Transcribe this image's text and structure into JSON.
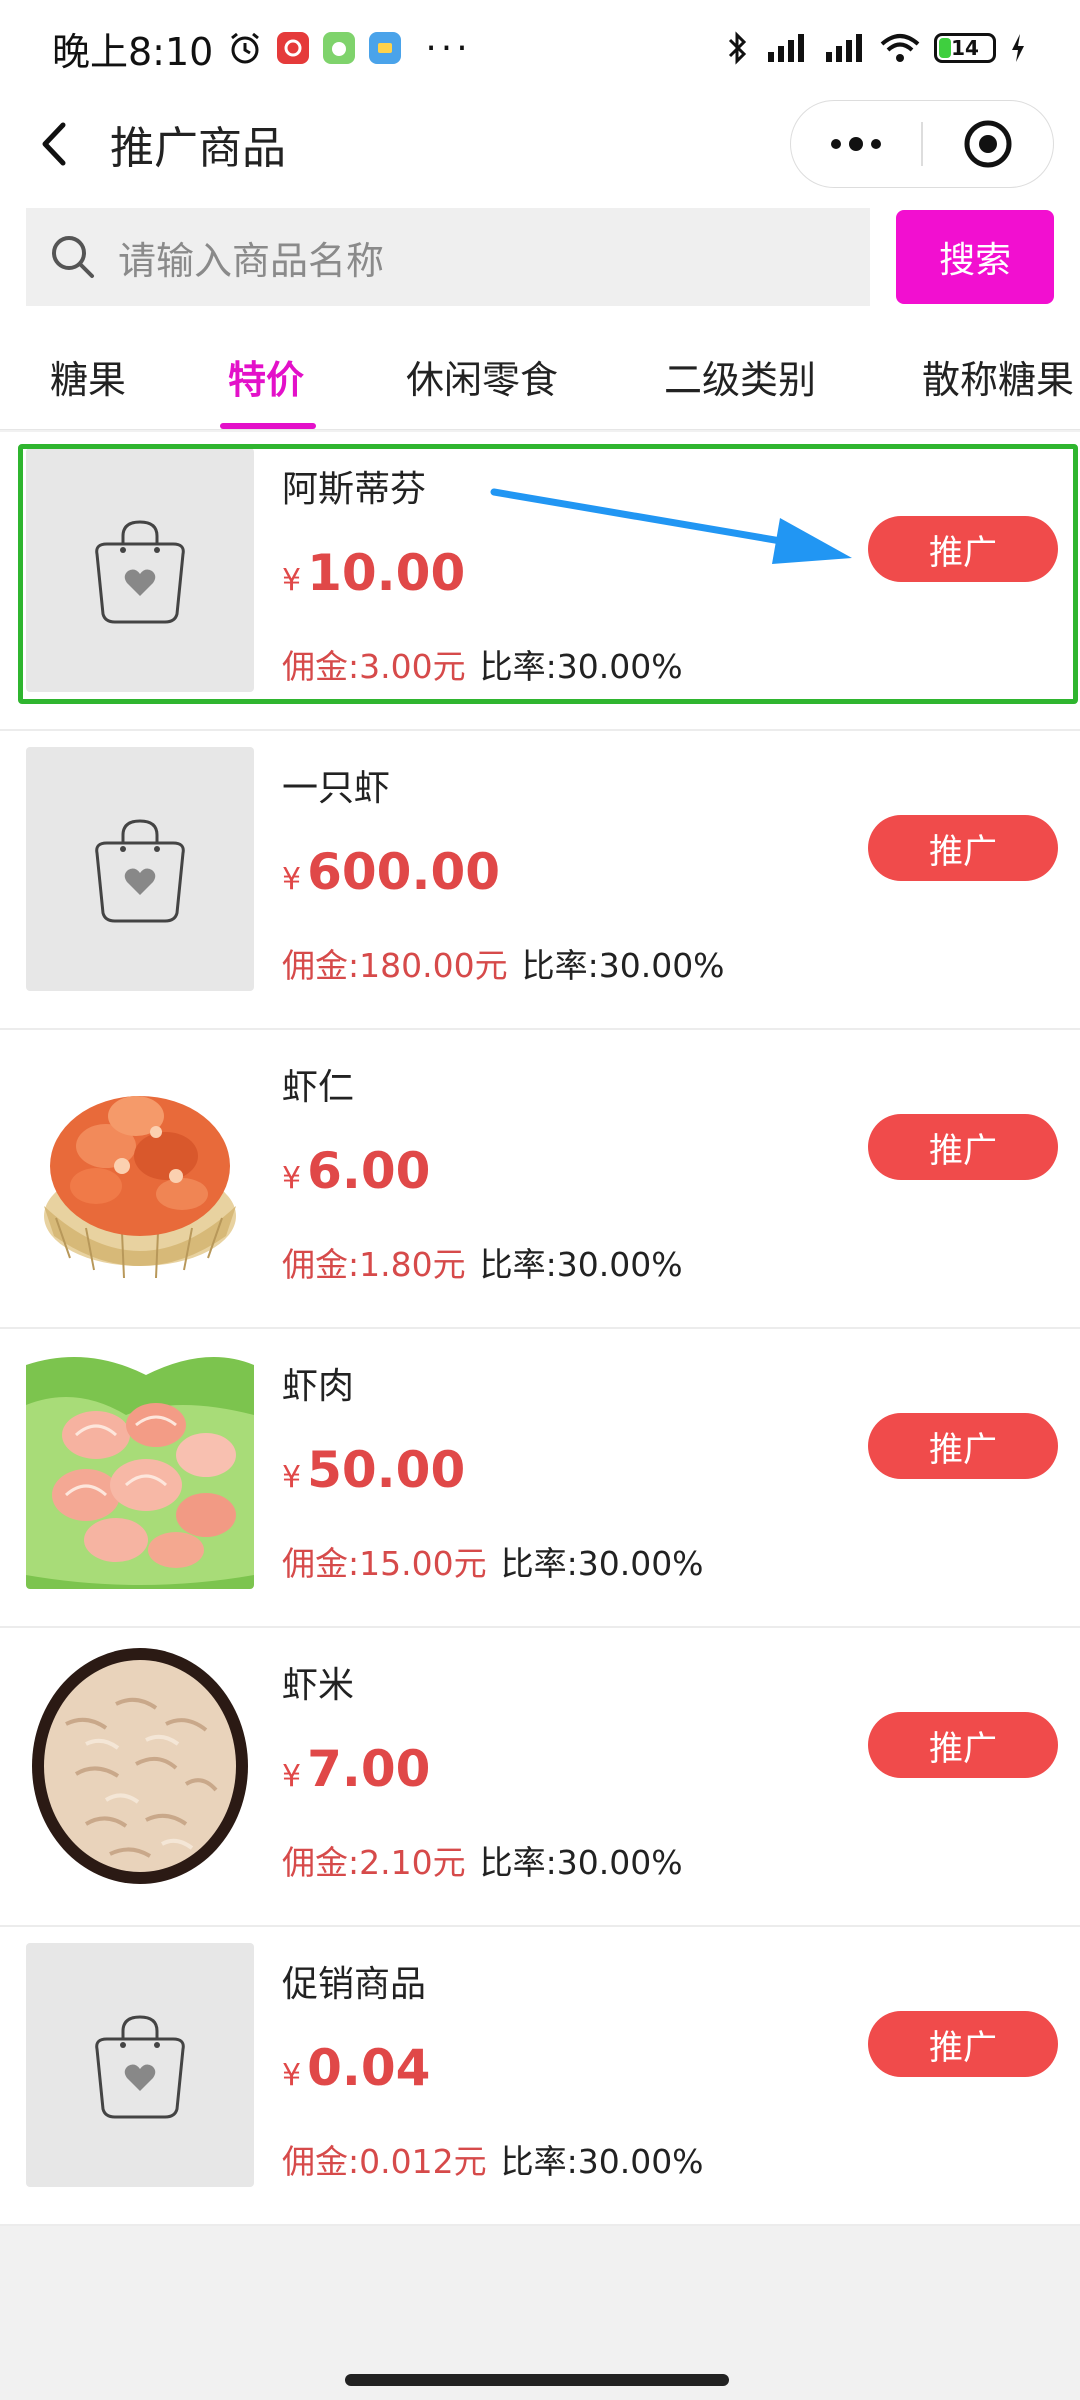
{
  "status_bar": {
    "time": "晚上8:10",
    "dots": "···",
    "battery": "14",
    "icons": [
      "alarm-icon",
      "app-icon-red",
      "app-icon-green",
      "app-icon-blue",
      "bluetooth-icon",
      "signal-hd-icon",
      "signal-hd-icon",
      "wifi-icon",
      "battery-icon",
      "charging-icon"
    ]
  },
  "nav": {
    "title": "推广商品"
  },
  "search": {
    "placeholder": "请输入商品名称",
    "button_label": "搜索"
  },
  "tabs": [
    {
      "label": "糖果",
      "active": false
    },
    {
      "label": "特价",
      "active": true
    },
    {
      "label": "休闲零食",
      "active": false
    },
    {
      "label": "二级类别",
      "active": false
    },
    {
      "label": "散称糖果",
      "active": false
    }
  ],
  "items": [
    {
      "name": "阿斯蒂芬",
      "yen": "¥",
      "price": "10.00",
      "commission": "佣金:3.00元",
      "rate": "比率:30.00%",
      "button": "推广",
      "image": "placeholder-bag"
    },
    {
      "name": "一只虾",
      "yen": "¥",
      "price": "600.00",
      "commission": "佣金:180.00元",
      "rate": "比率:30.00%",
      "button": "推广",
      "image": "placeholder-bag"
    },
    {
      "name": "虾仁",
      "yen": "¥",
      "price": "6.00",
      "commission": "佣金:1.80元",
      "rate": "比率:30.00%",
      "button": "推广",
      "image": "dried-shrimp-basket"
    },
    {
      "name": "虾肉",
      "yen": "¥",
      "price": "50.00",
      "commission": "佣金:15.00元",
      "rate": "比率:30.00%",
      "button": "推广",
      "image": "shrimp-meat-lettuce"
    },
    {
      "name": "虾米",
      "yen": "¥",
      "price": "7.00",
      "commission": "佣金:2.10元",
      "rate": "比率:30.00%",
      "button": "推广",
      "image": "dried-shrimp-bowl"
    },
    {
      "name": "促销商品",
      "yen": "¥",
      "price": "0.04",
      "commission": "佣金:0.012元",
      "rate": "比率:30.00%",
      "button": "推广",
      "image": "placeholder-bag"
    }
  ],
  "colors": {
    "accent": "#e311c9",
    "search_button": "#f20fd0",
    "price": "#e04848",
    "promote_button": "#f04b4b",
    "highlight_border": "#2fb52f",
    "arrow": "#2196f3"
  }
}
